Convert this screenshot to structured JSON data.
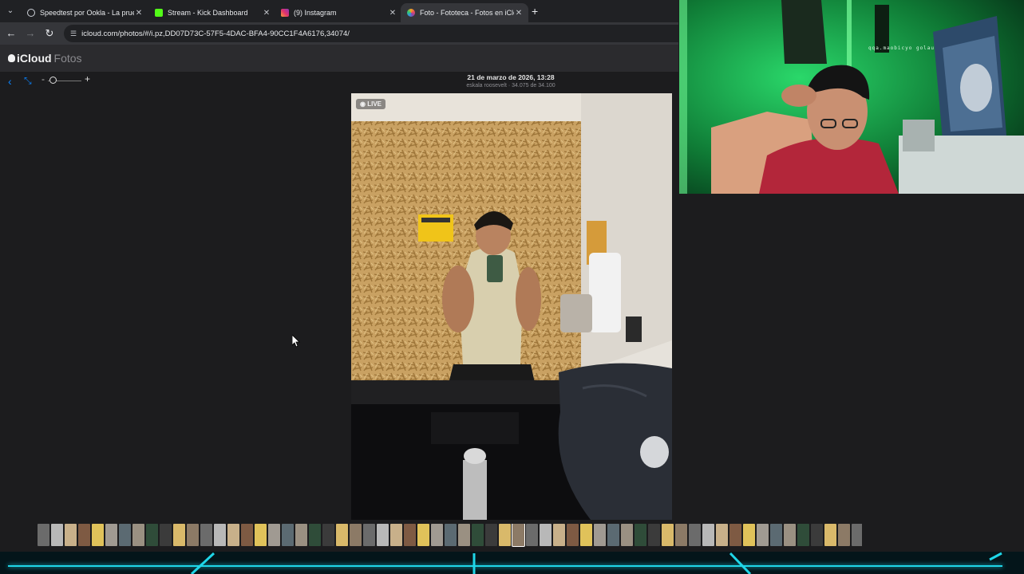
{
  "browser": {
    "tabs": [
      {
        "title": "Speedtest por Ookla - La prueb",
        "favicon_color": "#cfd3da",
        "active": false
      },
      {
        "title": "Stream - Kick Dashboard",
        "favicon_color": "#53fc18",
        "active": false
      },
      {
        "title": "(9) Instagram",
        "favicon_color": "#e1306c",
        "active": false
      },
      {
        "title": "Foto - Fototeca - Fotos en iClo",
        "favicon_color": "#f5a623",
        "active": true
      }
    ],
    "url": "icloud.com/photos/#/i.pz,DD07D73C-57F5-4DAC-BFA4-90CC1F4A6176,34074/"
  },
  "app": {
    "brand": "iCloud",
    "section": "Fotos"
  },
  "viewer": {
    "date": "21 de marzo de 2026, 13:28",
    "subtitle": "eskala roosevelt · 34.075 de 34.100",
    "live_label": "LIVE"
  },
  "theme": {
    "accent": "#0a84ff",
    "webcam_glow": "#1fd07a",
    "cyan": "#1fd6e8"
  },
  "overlay": {
    "poster_text": "qqa.maobicyo golau"
  }
}
